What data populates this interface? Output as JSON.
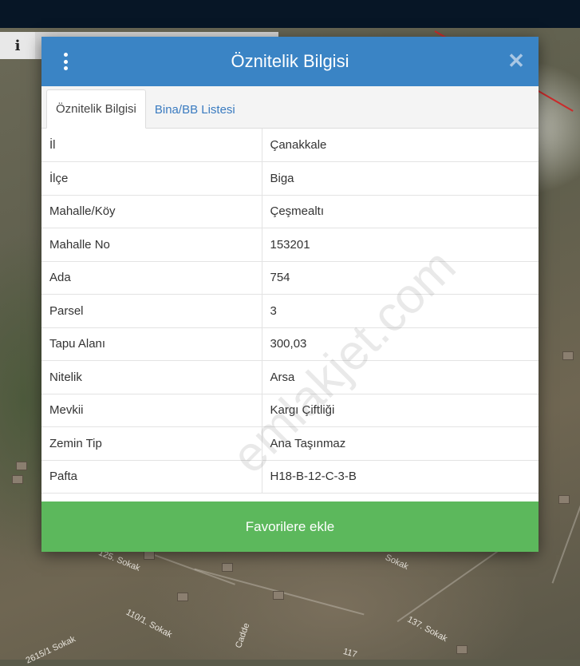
{
  "modal": {
    "title": "Öznitelik Bilgisi",
    "tabs": [
      {
        "label": "Öznitelik Bilgisi",
        "active": true
      },
      {
        "label": "Bina/BB Listesi",
        "active": false
      }
    ],
    "rows": [
      {
        "key": "İl",
        "value": "Çanakkale"
      },
      {
        "key": "İlçe",
        "value": "Biga"
      },
      {
        "key": "Mahalle/Köy",
        "value": "Çeşmealtı"
      },
      {
        "key": "Mahalle No",
        "value": "153201"
      },
      {
        "key": "Ada",
        "value": "754"
      },
      {
        "key": "Parsel",
        "value": "3"
      },
      {
        "key": "Tapu Alanı",
        "value": "300,03"
      },
      {
        "key": "Nitelik",
        "value": "Arsa"
      },
      {
        "key": "Mevkii",
        "value": "Kargı Çiftliği"
      },
      {
        "key": "Zemin Tip",
        "value": "Ana Taşınmaz"
      },
      {
        "key": "Pafta",
        "value": "H18-B-12-C-3-B"
      }
    ],
    "favorite_label": "Favorilere ekle"
  },
  "map": {
    "info_label": "i",
    "streets": [
      "125. Sokak",
      "110/1. Sokak",
      "137. Sokak",
      "2615/1 Sokak",
      "Cadde",
      "Sokak",
      "117"
    ]
  },
  "watermark": "emlakjet.com",
  "colors": {
    "header": "#3a84c5",
    "favorite_button": "#5cb85c",
    "tab_link": "#3a7bc0"
  }
}
